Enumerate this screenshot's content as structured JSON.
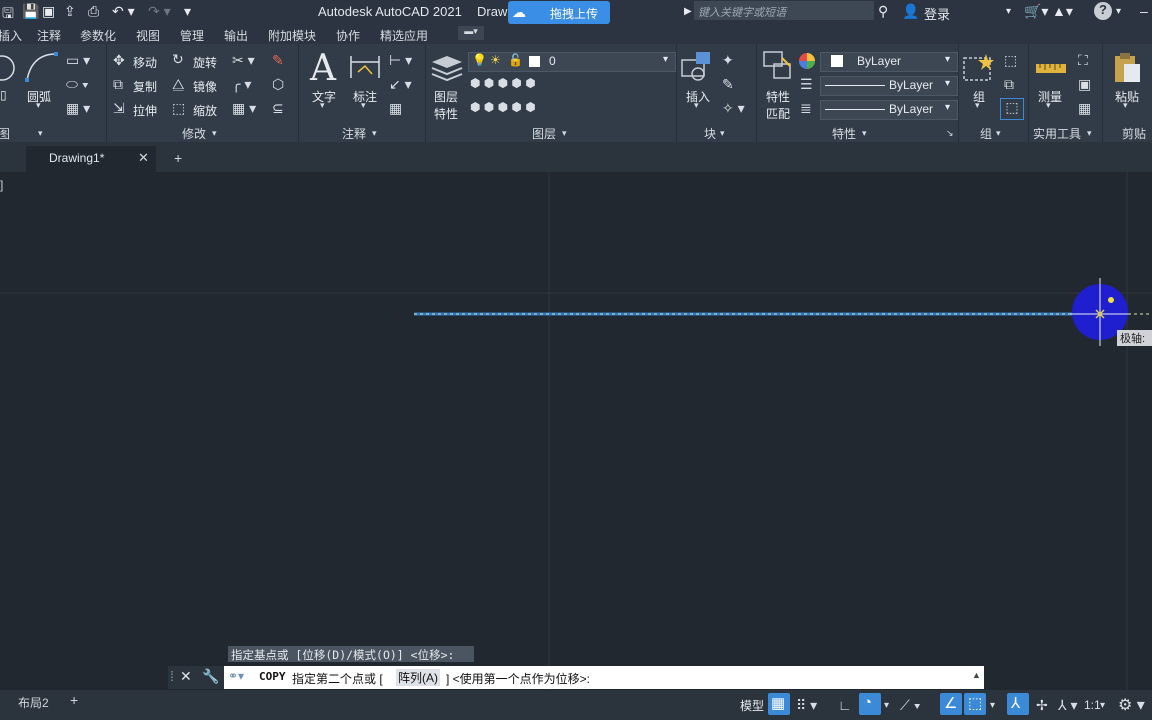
{
  "titlebar": {
    "app_title": "Autodesk AutoCAD 2021",
    "doc_fragment": "Draw",
    "baidu_label": "拖拽上传",
    "search_placeholder": "键入关键字或短语",
    "login": "登录"
  },
  "menubar": [
    "插入",
    "注释",
    "参数化",
    "视图",
    "管理",
    "输出",
    "附加模块",
    "协作",
    "精选应用"
  ],
  "ribbon": {
    "draw": {
      "arc": "圆弧",
      "panel_fragment": "图"
    },
    "modify": {
      "move": "移动",
      "rotate": "旋转",
      "copy": "复制",
      "mirror": "镜像",
      "stretch": "拉伸",
      "scale": "缩放",
      "panel": "修改"
    },
    "annotation": {
      "text": "文字",
      "dimension": "标注",
      "panel": "注释"
    },
    "layers": {
      "layer_props_1": "图层",
      "layer_props_2": "特性",
      "current_layer": "0",
      "panel": "图层"
    },
    "block": {
      "insert": "插入",
      "panel": "块"
    },
    "properties": {
      "match_1": "特性",
      "match_2": "匹配",
      "color": "ByLayer",
      "linetype": "ByLayer",
      "lineweight": "ByLayer",
      "panel": "特性"
    },
    "groups": {
      "group": "组",
      "panel": "组"
    },
    "utilities": {
      "measure": "测量",
      "panel": "实用工具"
    },
    "clipboard": {
      "paste": "粘贴",
      "panel": "剪贴"
    }
  },
  "tabs": {
    "active": "Drawing1*",
    "close": "✕",
    "add": "+"
  },
  "canvas": {
    "polar_tooltip": "极轴:",
    "viewport_bracket": "]"
  },
  "command": {
    "history": "指定基点或 [位移(D)/模式(O)] <位移>:",
    "cmd_name": "COPY",
    "prompt_a": "指定第二个点或 [",
    "option": "阵列(A)",
    "prompt_b": "] <使用第一个点作为位移>:"
  },
  "status": {
    "layout": "布局2",
    "add": "+",
    "model": "模型",
    "scale": "1:1"
  },
  "colors": {
    "accent_blue": "#3b8ad8",
    "background": "#212830",
    "cursor_blob": "#1f1fd0"
  }
}
